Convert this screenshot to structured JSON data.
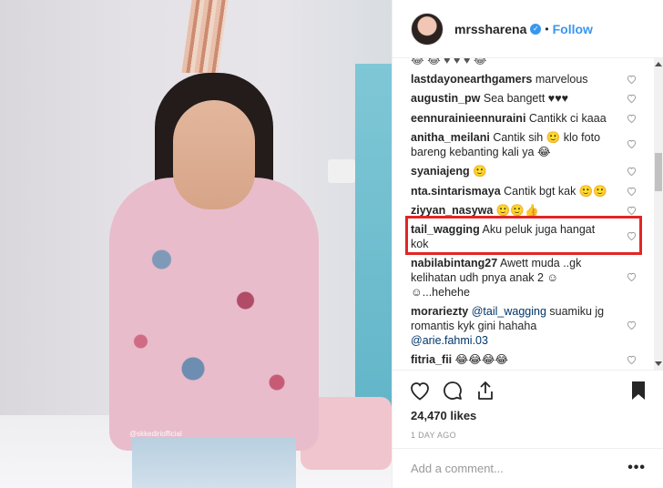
{
  "header": {
    "username": "mrssharena",
    "verified_glyph": "✓",
    "separator": "•",
    "follow_label": "Follow"
  },
  "comments": [
    {
      "user": "lastdayonearthgamers",
      "text": "marvelous"
    },
    {
      "user": "augustin_pw",
      "text": "Sea bangett ♥♥♥"
    },
    {
      "user": "eennurainieennuraini",
      "text": "Cantikk ci kaaa"
    },
    {
      "user": "anitha_meilani",
      "text": "Cantik sih 🙂 klo foto",
      "text2": "bareng kebanting kali ya 😂"
    },
    {
      "user": "syaniajeng",
      "text": "🙂"
    },
    {
      "user": "nta.sintarismaya",
      "text": "Cantik bgt kak 🙂🙂"
    },
    {
      "user": "ziyyan_nasywa",
      "text": "🙂🙂👍"
    },
    {
      "user": "tail_wagging",
      "text": "Aku peluk juga hangat",
      "text2": "kok"
    },
    {
      "user": "nabilabintang27",
      "text": "Awett muda ..gk",
      "text2": "kelihatan udh pnya anak 2 ☺",
      "text3": "☺...hehehe"
    },
    {
      "user": "morariezty",
      "mention": "@tail_wagging",
      "text": "suamiku jg",
      "text2": "romantis kyk gini hahaha",
      "mention2": "@arie.fahmi.03"
    },
    {
      "user": "fitria_fii",
      "text": "😂😂😂😂"
    }
  ],
  "partial_top_text": "😂 😂 ♥ ♥ ♥ 😂",
  "actions": {
    "likes": "24,470 likes",
    "time_ago": "1 DAY AGO"
  },
  "add_comment": {
    "placeholder": "Add a comment...",
    "more_label": "•••"
  },
  "photo": {
    "watermark": "@skkediriofficial"
  },
  "colors": {
    "accent": "#3897f0",
    "highlight": "#e22525"
  }
}
